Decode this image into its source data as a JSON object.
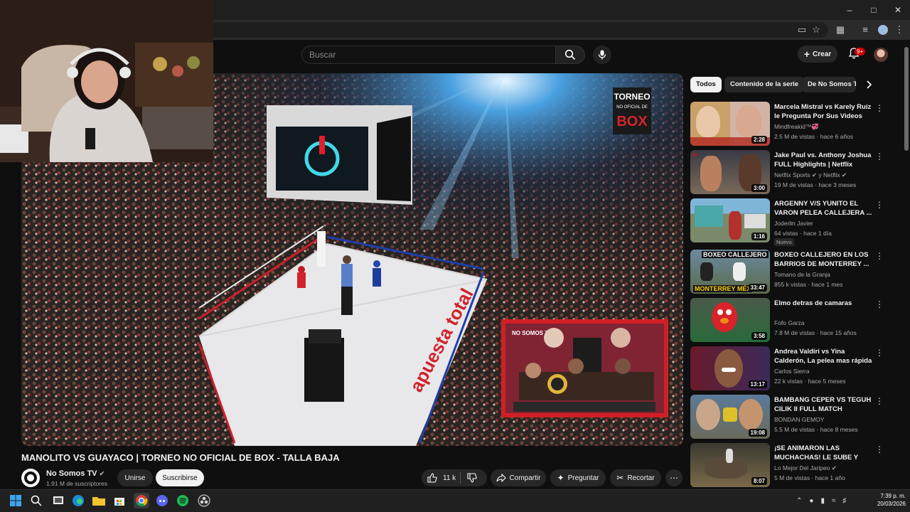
{
  "browser": {
    "window_controls": [
      "minimize",
      "maximize",
      "close"
    ],
    "toolbar_icons": [
      "cast-icon",
      "star-icon",
      "extensions-icon",
      "playlist-icon",
      "profile-icon",
      "menu-icon"
    ]
  },
  "header": {
    "search_placeholder": "Buscar",
    "create_label": "Crear",
    "notifications_badge": "9+"
  },
  "video": {
    "title": "MANOLITO VS GUAYACO | TORNEO NO OFICIAL DE BOX - TALLA BAJA",
    "channel": "No Somos TV",
    "subscribers": "1.91 M de suscriptores",
    "join_label": "Unirse",
    "subscribe_label": "Suscribirse",
    "likes": "11 k",
    "share_label": "Compartir",
    "ask_label": "Preguntar",
    "clip_label": "Recortar",
    "overlay_logo_line1": "TORNEO",
    "overlay_logo_line2": "NO OFICIAL DE",
    "overlay_logo_line3": "BOX",
    "ring_sponsor": "apuesta total",
    "inset_brand": "NO SOMOS TV"
  },
  "chips": [
    "Todos",
    "Contenido de la serie",
    "De No Somos TV"
  ],
  "recommendations": [
    {
      "title": "Marcela Mistral vs Karely Ruiz le Pregunta Por Sus Videos En...",
      "channel": "Mindfreakid™💞",
      "meta": "2.5 M de vistas · hace 6 años",
      "duration": "2:28",
      "new": ""
    },
    {
      "title": "Jake Paul vs. Anthony Joshua FULL Highlights | Netflix",
      "channel": "Netflix Sports ✔ y Netflix ✔",
      "meta": "19 M de vistas · hace 3 meses",
      "duration": "3:00",
      "new": ""
    },
    {
      "title": "ARGENNY V/S YUNITO EL VARON PELEA CALLEJERA ...",
      "channel": "Joderlin Javier",
      "meta": "64 vistas · hace 1 día",
      "duration": "1:16",
      "new": "Nuevo"
    },
    {
      "title": "BOXEO CALLEJERO EN LOS BARRIOS DE MONTERREY ...",
      "channel": "Tomano de la Granja",
      "meta": "855 k vistas · hace 1 mes",
      "duration": "33:47",
      "new": "",
      "thumb_text1": "BOXEO CALLEJERO",
      "thumb_text2": "MONTERREY MÉX"
    },
    {
      "title": "Elmo detras de camaras",
      "channel": "Fofo Garza",
      "meta": "7.8 M de vistas · hace 15 años",
      "duration": "3:58",
      "new": ""
    },
    {
      "title": "Andrea Valdiri vs Yina Calderón, La pelea mas rápida",
      "channel": "Carlos Sierra",
      "meta": "22 k vistas · hace 5 meses",
      "duration": "13:17",
      "new": ""
    },
    {
      "title": "BAMBANG CEPER VS TEGUH CILIK II FULL MATCH SHADUK...",
      "channel": "BONDAN GEMOY",
      "meta": "5.5 M de vistas · hace 8 meses",
      "duration": "19:08",
      "new": ""
    },
    {
      "title": "¡SE ANIMARON LAS MUCHACHAS! LE SUBE Y BAJ...",
      "channel": "Lo Mejor Del Jaripeo ✔",
      "meta": "5 M de vistas · hace 1 año",
      "duration": "8:07",
      "new": ""
    }
  ],
  "taskbar": {
    "apps": [
      "windows-start-icon",
      "search-icon",
      "task-view-icon",
      "edge-icon",
      "file-explorer-icon",
      "store-icon",
      "chrome-icon",
      "discord-icon",
      "spotify-icon",
      "obs-icon"
    ],
    "time": "7:39 p. m.",
    "date": "20/03/2026"
  },
  "colors": {
    "bg": "#0f0f0f",
    "surface": "#272727",
    "accent_red": "#cc0000",
    "text": "#f1f1f1",
    "muted": "#aaaaaa"
  }
}
